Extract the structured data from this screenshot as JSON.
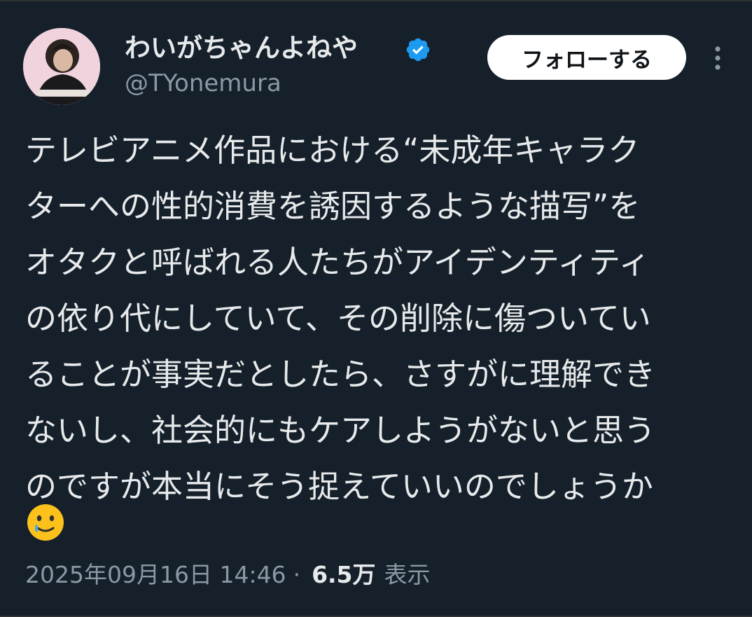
{
  "user": {
    "display_name": "わいがちゃんよねや",
    "handle": "@TYonemura",
    "verified": true,
    "verified_color": "#1d9bf0"
  },
  "actions": {
    "follow_label": "フォローする",
    "more_icon": "more-vertical-icon"
  },
  "tweet": {
    "text": "テレビアニメ作品における“未成年キャラク\nターへの性的消費を誘因するような描写”を\nオタクと呼ばれる人たちがアイデンティティ\nの依り代にしていて、その削除に傷ついてい\nることが事実だとしたら、さすがに理解でき\nないし、社会的にもケアしようがないと思う\nのですが本当にそう捉えていいのでしょうか",
    "emoji": "smiling-face-with-tear-emoji"
  },
  "meta": {
    "timestamp": "2025年09月16日 14:46",
    "separator": "·",
    "views_count": "6.5万",
    "views_label": "表示"
  },
  "colors": {
    "background": "#15202b",
    "text": "#e7e9ea",
    "secondary_text": "#8b98a5"
  }
}
